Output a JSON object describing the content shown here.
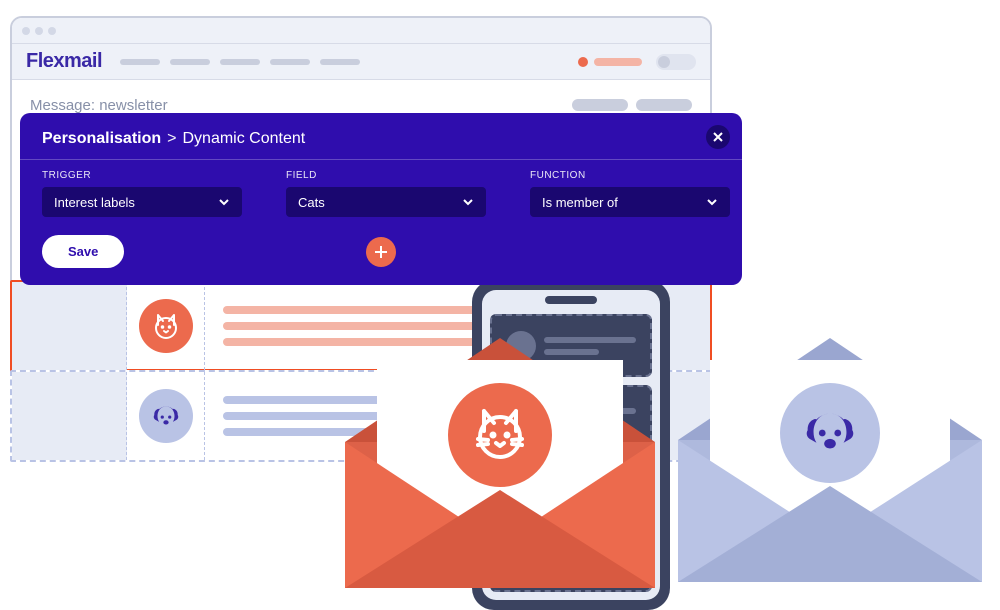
{
  "brand": "Flexmail",
  "message_label": "Message: newsletter",
  "panel": {
    "breadcrumb_root": "Personalisation",
    "breadcrumb_current": "Dynamic Content",
    "trigger": {
      "label": "TRIGGER",
      "value": "Interest labels"
    },
    "field": {
      "label": "FIELD",
      "value": "Cats"
    },
    "function": {
      "label": "FUNCTION",
      "value": "Is member of"
    },
    "save": "Save"
  },
  "colors": {
    "coral": "#ec6a4d",
    "indigo": "#2f0dad",
    "slate": "#3b4360",
    "lilac": "#b9c3e5"
  }
}
